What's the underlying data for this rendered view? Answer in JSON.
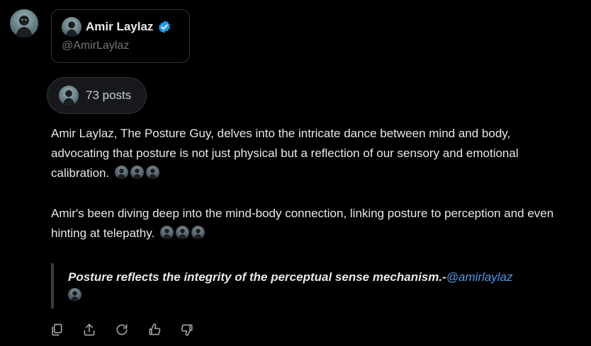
{
  "profile": {
    "name": "Amir Laylaz",
    "handle": "@AmirLaylaz",
    "verified": true,
    "verified_color": "#1d9bf0"
  },
  "posts_pill": {
    "label": "73 posts"
  },
  "paragraphs": [
    {
      "text": "Amir Laylaz, The Posture Guy, delves into the intricate dance between mind and body, advocating that posture is not just physical but a reflection of our sensory and emotional calibration.",
      "emoji_count": 3
    },
    {
      "text": "Amir's been diving deep into the mind-body connection, linking posture to perception and even hinting at telepathy.",
      "emoji_count": 3
    }
  ],
  "quote": {
    "text": "Posture reflects the integrity of the perceptual sense mechanism.-",
    "mention": "@amirlaylaz",
    "mention_color": "#4b9ce6"
  },
  "actions": [
    {
      "icon": "copy-icon"
    },
    {
      "icon": "share-icon"
    },
    {
      "icon": "regenerate-icon"
    },
    {
      "icon": "thumbs-up-icon"
    },
    {
      "icon": "thumbs-down-icon"
    }
  ]
}
